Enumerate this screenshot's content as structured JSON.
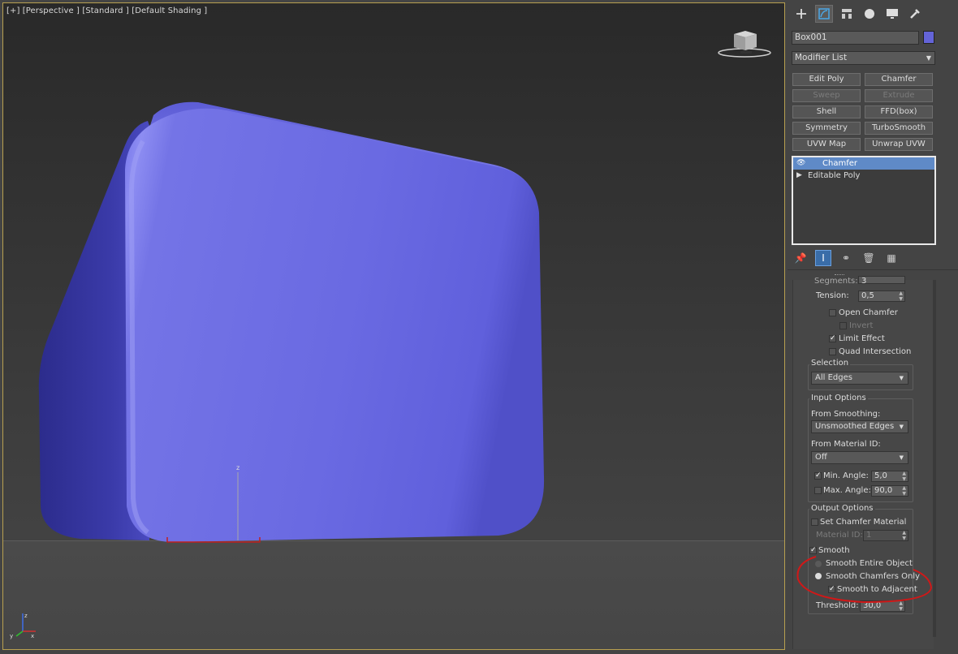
{
  "viewport": {
    "label": "[+] [Perspective ] [Standard ] [Default Shading ]",
    "object_color": "#6a6ae0",
    "gizmo_axis_label": "z",
    "tripod_labels": {
      "x": "x",
      "y": "y",
      "z": "z"
    }
  },
  "command_panel": {
    "tabs": [
      "create-icon",
      "modify-icon",
      "hierarchy-icon",
      "motion-icon",
      "display-icon",
      "utilities-icon"
    ],
    "object_name": "Box001",
    "object_color": "#6464d8",
    "modifier_list": "Modifier List",
    "modifier_buttons": [
      {
        "label": "Edit Poly",
        "enabled": true
      },
      {
        "label": "Chamfer",
        "enabled": true
      },
      {
        "label": "Sweep",
        "enabled": false
      },
      {
        "label": "Extrude",
        "enabled": false
      },
      {
        "label": "Shell",
        "enabled": true
      },
      {
        "label": "FFD(box)",
        "enabled": true
      },
      {
        "label": "Symmetry",
        "enabled": true
      },
      {
        "label": "TurboSmooth",
        "enabled": true
      },
      {
        "label": "UVW Map",
        "enabled": true
      },
      {
        "label": "Unwrap UVW",
        "enabled": true
      }
    ],
    "stack": [
      {
        "label": "Chamfer",
        "selected": true
      },
      {
        "label": "Editable Poly",
        "selected": false
      }
    ]
  },
  "params": {
    "segments_label": "Segments:",
    "segments_value": "3",
    "tension_label": "Tension:",
    "tension_value": "0,5",
    "open_chamfer": "Open Chamfer",
    "invert": "Invert",
    "limit_effect": "Limit Effect",
    "quad_intersection": "Quad Intersection",
    "selection_title": "Selection",
    "selection_value": "All Edges",
    "input_options_title": "Input Options",
    "from_smoothing_label": "From Smoothing:",
    "from_smoothing_value": "Unsmoothed Edges",
    "from_material_label": "From Material ID:",
    "from_material_value": "Off",
    "min_angle_label": "Min. Angle:",
    "min_angle_value": "5,0",
    "max_angle_label": "Max. Angle:",
    "max_angle_value": "90,0",
    "output_options_title": "Output Options",
    "set_chamfer_material": "Set Chamfer Material",
    "material_id_label": "Material ID:",
    "material_id_value": "1",
    "smooth": "Smooth",
    "smooth_entire": "Smooth Entire Object",
    "smooth_chamfers": "Smooth Chamfers Only",
    "smooth_adjacent": "Smooth to Adjacent",
    "threshold_label": "Threshold:",
    "threshold_value": "30,0"
  },
  "annotation_color": "#d01818"
}
